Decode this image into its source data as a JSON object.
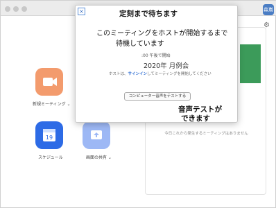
{
  "app": {
    "avatar_text": "森嶌",
    "home_actions": [
      {
        "label": "新規ミーティング ⌄",
        "icon": "video-camera-icon",
        "color": "#f39b6d"
      },
      {
        "label": "スケジュール",
        "icon": "calendar-icon",
        "date": "19",
        "color": "#2d6be6"
      },
      {
        "label": "画面の共有 ⌄",
        "icon": "share-screen-icon",
        "color": "#9db8f5"
      }
    ],
    "no_meetings_text": "今日これから発生するミーティングはありません"
  },
  "dialog": {
    "annotation_top": "定刻まで待ちます",
    "host_wait_line1": "このミーティングをホストが開始するまで",
    "host_wait_line2": "待機しています",
    "start_time": ":00 午後で開始",
    "meeting_title": "2020年 月例会",
    "host_note_prefix": "ホストは、",
    "host_note_link": "サインイン",
    "host_note_suffix": "してミーティングを開始してください",
    "test_audio_button": "コンピューター音声をテストする",
    "annotation_bottom_line1": "音声テストが",
    "annotation_bottom_line2": "できます"
  }
}
